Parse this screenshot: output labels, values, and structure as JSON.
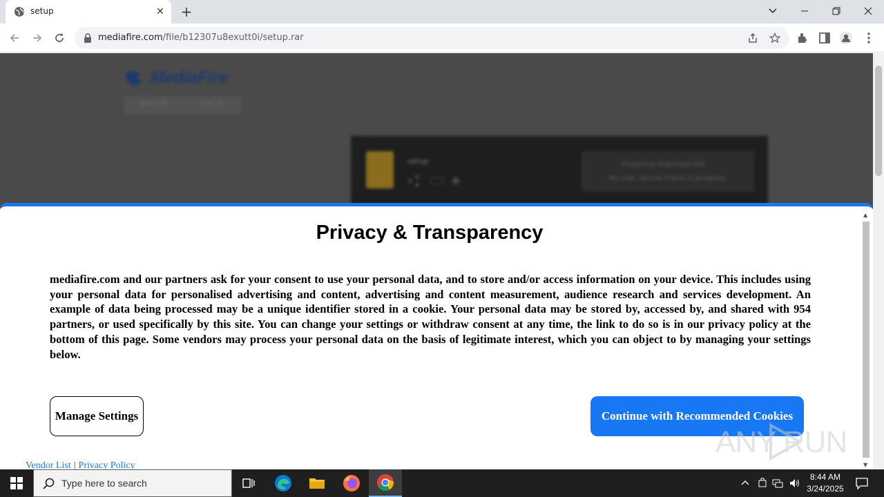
{
  "browser": {
    "tab": {
      "title": "setup",
      "close_glyph": "✕"
    },
    "new_tab_glyph": "+",
    "url": {
      "host": "mediafire.com",
      "path": "/file/b12307u8exutt0i/setup.rar"
    },
    "window_buttons": {
      "minimize": "—",
      "maximize": "❐",
      "close": "✕",
      "tab_search": "⌄"
    }
  },
  "background_site": {
    "logo_text": "MediaFire",
    "nav": [
      "SIGN UP",
      "LOG IN"
    ],
    "file_name": "setup",
    "download_lines": [
      "Preparing download link",
      "No cost, secure check in progress"
    ]
  },
  "consent": {
    "title": "Privacy & Transparency",
    "body": "mediafire.com and our partners ask for your consent to use your personal data, and to store and/or access information on your device. This includes using your personal data for personalised advertising and content, advertising and content measurement, audience research and services development. An example of data being processed may be a unique identifier stored in a cookie. Your personal data may be stored by, accessed by, and shared with 954 partners, or used specifically by this site. You can change your settings or withdraw consent at any time, the link to do so is in our privacy policy at the bottom of this page. Some vendors may process your personal data on the basis of legitimate interest, which you can object to by managing your settings below.",
    "manage_label": "Manage Settings",
    "continue_label": "Continue with Recommended Cookies",
    "vendor_link": "Vendor List",
    "link_separator": "|",
    "privacy_link": "Privacy Policy",
    "accent": "#1877f2"
  },
  "watermark": {
    "text": "ANY RUN"
  },
  "taskbar": {
    "search_placeholder": "Type here to search",
    "time": "8:44 AM",
    "date": "3/24/2025"
  }
}
